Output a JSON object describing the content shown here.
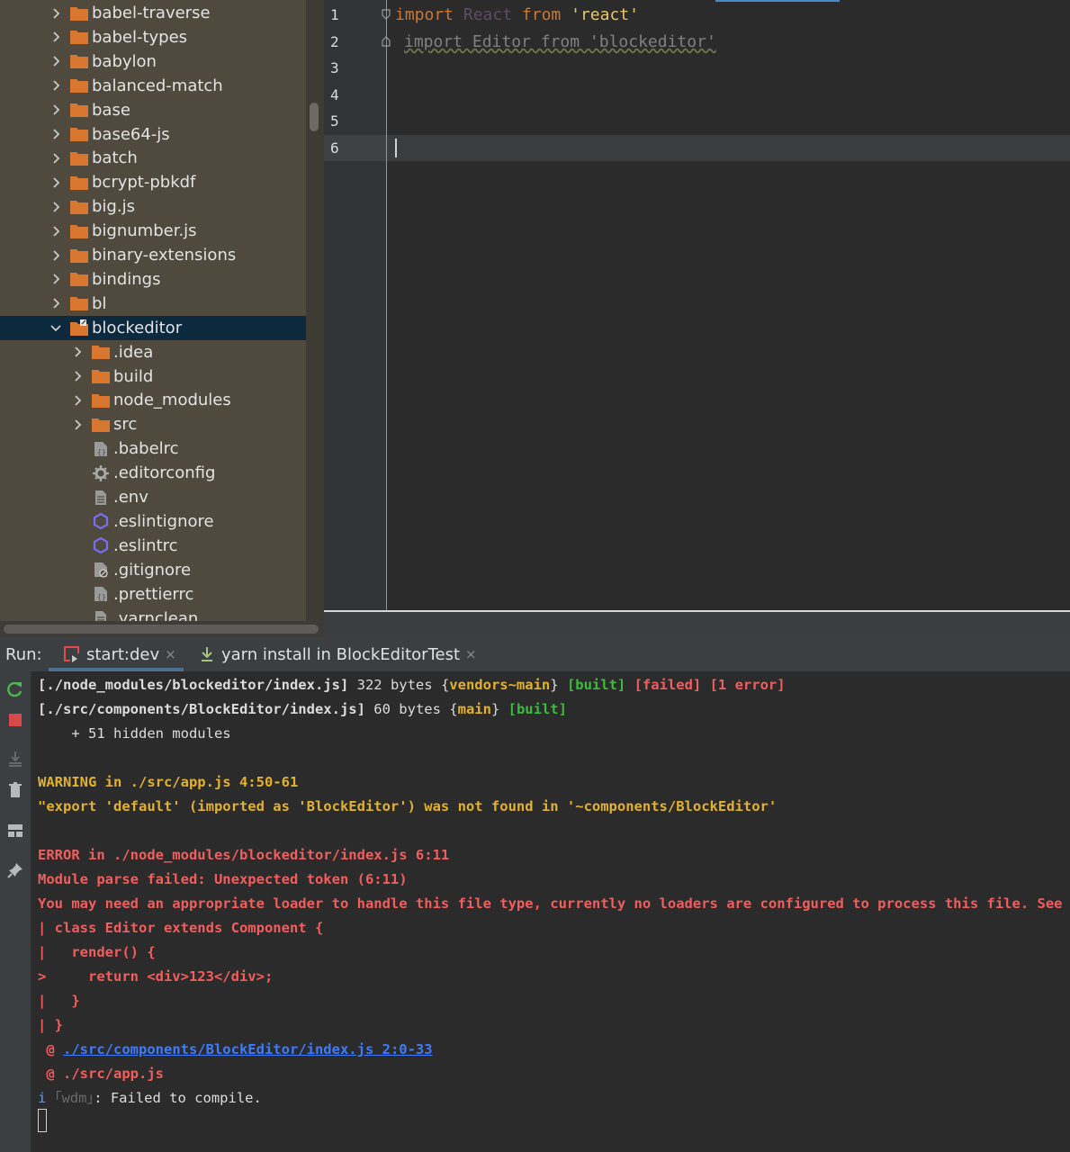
{
  "project_tree": {
    "items": [
      {
        "label": "babel-traverse",
        "icon": "folder-icon",
        "expanded": false
      },
      {
        "label": "babel-types",
        "icon": "folder-icon",
        "expanded": false
      },
      {
        "label": "babylon",
        "icon": "folder-icon",
        "expanded": false
      },
      {
        "label": "balanced-match",
        "icon": "folder-icon",
        "expanded": false
      },
      {
        "label": "base",
        "icon": "folder-icon",
        "expanded": false
      },
      {
        "label": "base64-js",
        "icon": "folder-icon",
        "expanded": false
      },
      {
        "label": "batch",
        "icon": "folder-icon",
        "expanded": false
      },
      {
        "label": "bcrypt-pbkdf",
        "icon": "folder-icon",
        "expanded": false
      },
      {
        "label": "big.js",
        "icon": "folder-icon",
        "expanded": false
      },
      {
        "label": "bignumber.js",
        "icon": "folder-icon",
        "expanded": false
      },
      {
        "label": "binary-extensions",
        "icon": "folder-icon",
        "expanded": false
      },
      {
        "label": "bindings",
        "icon": "folder-icon",
        "expanded": false
      },
      {
        "label": "bl",
        "icon": "folder-icon",
        "expanded": false
      },
      {
        "label": "blockeditor",
        "icon": "linked-folder-icon",
        "expanded": true,
        "selected": true
      },
      {
        "label": ".idea",
        "icon": "folder-icon",
        "expanded": false,
        "child": true
      },
      {
        "label": "build",
        "icon": "folder-icon",
        "expanded": false,
        "child": true
      },
      {
        "label": "node_modules",
        "icon": "folder-icon",
        "expanded": false,
        "child": true
      },
      {
        "label": "src",
        "icon": "folder-icon",
        "expanded": false,
        "child": true
      },
      {
        "label": ".babelrc",
        "icon": "config-file-icon",
        "child": true,
        "file": true
      },
      {
        "label": ".editorconfig",
        "icon": "gear-icon",
        "child": true,
        "file": true
      },
      {
        "label": ".env",
        "icon": "text-file-icon",
        "child": true,
        "file": true
      },
      {
        "label": ".eslintignore",
        "icon": "eslint-icon",
        "child": true,
        "file": true
      },
      {
        "label": ".eslintrc",
        "icon": "eslint-icon",
        "child": true,
        "file": true
      },
      {
        "label": ".gitignore",
        "icon": "ignore-file-icon",
        "child": true,
        "file": true
      },
      {
        "label": ".prettierrc",
        "icon": "config-file-icon",
        "child": true,
        "file": true
      },
      {
        "label": ".yarnclean",
        "icon": "text-file-icon",
        "child": true,
        "file": true
      }
    ]
  },
  "editor": {
    "line_numbers": [
      "1",
      "2",
      "3",
      "4",
      "5",
      "6"
    ],
    "line1": {
      "kw": "import",
      "ident": "React",
      "from": "from",
      "str": "'react'"
    },
    "line2": {
      "text": "import Editor from 'blockeditor'"
    }
  },
  "run_panel": {
    "label": "Run:",
    "tabs": [
      {
        "label": "start:dev",
        "close": "×"
      },
      {
        "label": "yarn install in BlockEditorTest",
        "close": "×"
      }
    ]
  },
  "console": {
    "l1": {
      "path": "[./node_modules/blockeditor/index.js]",
      "size": " 322 bytes ",
      "chunk_open": "{",
      "chunk": "vendors~main",
      "chunk_close": "}",
      "built": " [built]",
      "failed": " [failed]",
      "errors": " [1 error]"
    },
    "l2": {
      "path": "[./src/components/BlockEditor/index.js]",
      "size": " 60 bytes ",
      "chunk_open": "{",
      "chunk": "main",
      "chunk_close": "}",
      "built": " [built]"
    },
    "l3": "    + 51 hidden modules",
    "warning_title": "WARNING in ./src/app.js 4:50-61",
    "warning_msg": "\"export 'default' (imported as 'BlockEditor') was not found in '~components/BlockEditor'",
    "error_title": "ERROR in ./node_modules/blockeditor/index.js 6:11",
    "error_msg": "Module parse failed: Unexpected token (6:11)",
    "error_hint": "You may need an appropriate loader to handle this file type, currently no loaders are configured to process this file. See",
    "code1": "| class Editor extends Component {",
    "code2": "|   render() {",
    "code3": ">     return <div>123</div>;",
    "code4": "|   }",
    "code5": "| }",
    "at1_prefix": " @ ",
    "at1_link": "./src/components/BlockEditor/index.js 2:0-33",
    "at2": " @ ./src/app.js",
    "wdm_i": "i",
    "wdm_tag": "｢wdm｣",
    "wdm_msg": ": Failed to compile."
  },
  "colors": {
    "tree_bg": "#4f4a3d",
    "folder": "#d9762f",
    "selected_row": "#0d293e",
    "editor_bg": "#2b2b2b",
    "warning": "#e2b12e",
    "error": "#f25d5d",
    "built": "#3dbb3d"
  }
}
